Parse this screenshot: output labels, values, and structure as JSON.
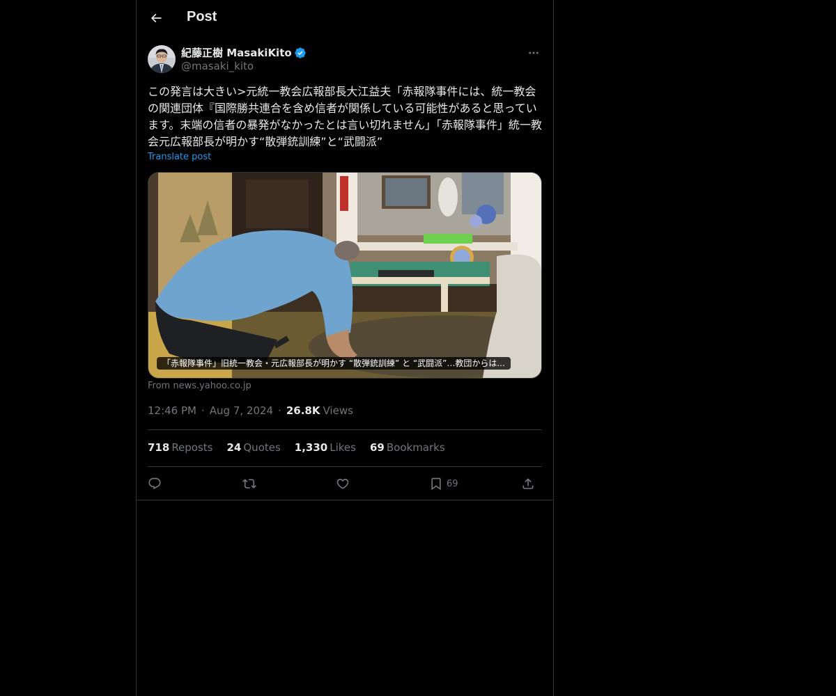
{
  "header": {
    "title": "Post",
    "back_icon": "arrow-left-icon"
  },
  "author": {
    "name": "紀藤正樹 MasakiKito",
    "handle": "@masaki_kito",
    "verified": true,
    "verified_color": "#1d9bf0",
    "more_icon": "more-horizontal-icon"
  },
  "post": {
    "text": "この発言は大きい>元統一教会広報部長大江益夫「赤報隊事件には、統一教会の関連団体『国際勝共連合を含め信者が関係している可能性があると思っています。末端の信者の暴発がなかったとは言い切れません」「赤報隊事件」統一教会元広報部長が明かす“散弾銃訓練”と“武闘派”",
    "translate_label": "Translate post"
  },
  "card": {
    "caption": "「赤報隊事件」旧統一教会・元広報部長が明かす “散弾銃訓練” と “武闘派”…教団からは...",
    "source": "From news.yahoo.co.jp"
  },
  "meta": {
    "time": "12:46 PM",
    "dot": "·",
    "date": "Aug 7, 2024",
    "views_count": "26.8K",
    "views_label": "Views"
  },
  "stats": [
    {
      "count": "718",
      "label": "Reposts"
    },
    {
      "count": "24",
      "label": "Quotes"
    },
    {
      "count": "1,330",
      "label": "Likes"
    },
    {
      "count": "69",
      "label": "Bookmarks"
    }
  ],
  "actions": {
    "reply_icon": "reply-icon",
    "repost_icon": "repost-icon",
    "like_icon": "heart-icon",
    "bookmark_icon": "bookmark-icon",
    "bookmark_count": "69",
    "share_icon": "share-icon"
  },
  "colors": {
    "background": "#000000",
    "text": "#e7e9ea",
    "muted": "#71767b",
    "accent": "#1d9bf0",
    "border": "#2f3336"
  }
}
